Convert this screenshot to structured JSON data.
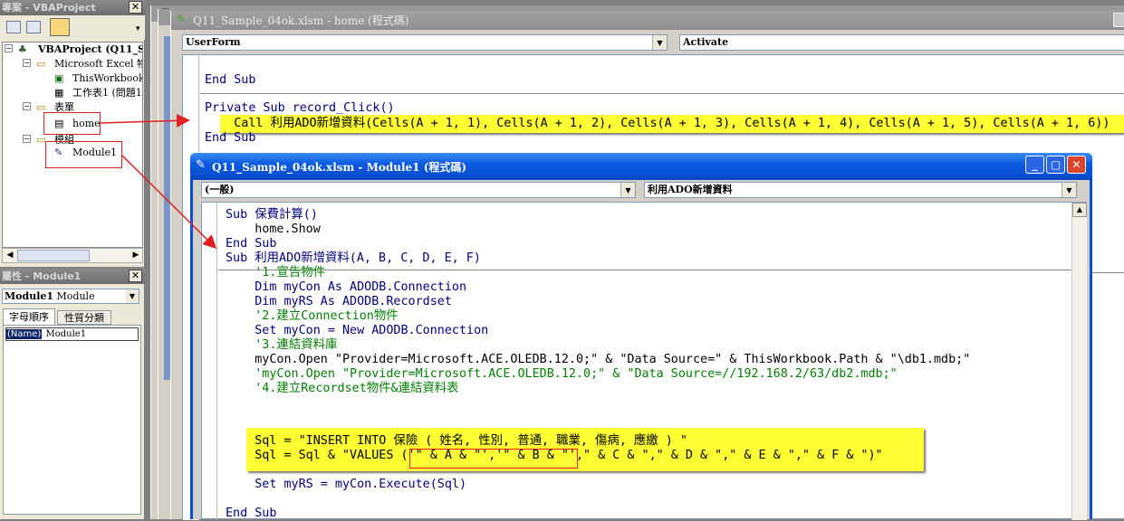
{
  "project_panel": {
    "title": "專案 - VBAProject",
    "tree": {
      "root": "VBAProject (Q11_S",
      "excel_objects": "Microsoft Excel 物件",
      "this_workbook": "ThisWorkbook",
      "sheet1": "工作表1 (問題1",
      "forms": "表單",
      "home": "home",
      "modules": "模組",
      "module1": "Module1"
    }
  },
  "properties_panel": {
    "title": "屬性 - Module1",
    "object_name": "Module1",
    "object_type": "Module",
    "tabs": [
      "字母順序",
      "性質分類"
    ],
    "prop_name": "(Name)",
    "prop_value": "Module1"
  },
  "home_window": {
    "title": "Q11_Sample_04ok.xlsm - home (程式碼)",
    "object_combo": "UserForm",
    "proc_combo": "Activate",
    "code": {
      "l1": "End Sub",
      "l2": "Private Sub record_Click()",
      "l3": "    Call 利用ADO新增資料(Cells(A + 1, 1), Cells(A + 1, 2), Cells(A + 1, 3), Cells(A + 1, 4), Cells(A + 1, 5), Cells(A + 1, 6))",
      "l4": "End Sub"
    }
  },
  "module_window": {
    "title": "Q11_Sample_04ok.xlsm - Module1 (程式碼)",
    "object_combo": "(一般)",
    "proc_combo": "利用ADO新增資料",
    "code": {
      "l1": "Sub 保費計算()",
      "l2": "    home.Show",
      "l3": "End Sub",
      "l4": "Sub 利用ADO新增資料(A, B, C, D, E, F)",
      "l5": "    '1.宣告物件",
      "l6": "    Dim myCon As ADODB.Connection",
      "l7": "    Dim myRS As ADODB.Recordset",
      "l8": "    '2.建立Connection物件",
      "l9": "    Set myCon = New ADODB.Connection",
      "l10": "    '3.連結資料庫",
      "l11": "    myCon.Open \"Provider=Microsoft.ACE.OLEDB.12.0;\" & \"Data Source=\" & ThisWorkbook.Path & \"\\db1.mdb;\"",
      "l12": "    'myCon.Open \"Provider=Microsoft.ACE.OLEDB.12.0;\" & \"Data Source=//192.168.2/63/db2.mdb;\"",
      "l13": "    '4.建立Recordset物件&連結資料表",
      "l14": "",
      "l15": "    Sql = \"INSERT INTO 保險 ( 姓名, 性別, 普通, 職業, 傷病, 應繳 ) \"",
      "l16": "    Sql = Sql & \"VALUES ('\" & A & \"','\" & B & \"',\" & C & \",\" & D & \",\" & E & \",\" & F & \")\"",
      "l17": "",
      "l18": "    Set myRS = myCon.Execute(Sql)",
      "l19": "",
      "l20": "End Sub"
    }
  }
}
